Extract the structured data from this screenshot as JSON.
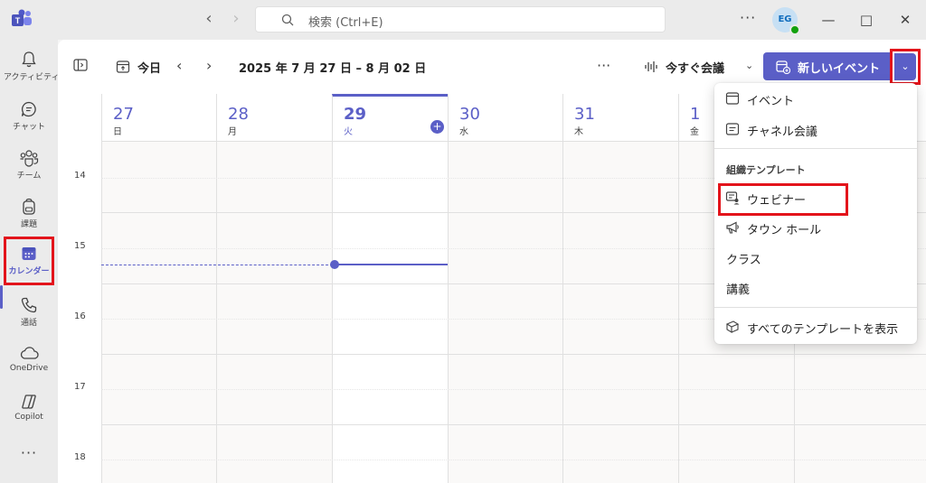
{
  "titlebar": {
    "search_placeholder": "検索 (Ctrl+E)",
    "more": "···",
    "avatar_initials": "EG",
    "minimize": "—",
    "maximize": "□",
    "close": "✕"
  },
  "rail": {
    "items": [
      {
        "label": "アクティビティ",
        "icon": "bell-icon"
      },
      {
        "label": "チャット",
        "icon": "chat-icon"
      },
      {
        "label": "チーム",
        "icon": "teams-icon"
      },
      {
        "label": "課題",
        "icon": "backpack-icon"
      },
      {
        "label": "カレンダー",
        "icon": "calendar-icon",
        "active": true
      },
      {
        "label": "通話",
        "icon": "phone-icon"
      },
      {
        "label": "OneDrive",
        "icon": "cloud-icon"
      },
      {
        "label": "Copilot",
        "icon": "copilot-icon"
      }
    ],
    "more": "···"
  },
  "toolbar": {
    "today_label": "今日",
    "date_range": "2025 年 7 月 27 日 – 8 月 02 日",
    "more": "···",
    "meet_now_label": "今すぐ会議",
    "new_event_label": "新しいイベント"
  },
  "calendar": {
    "days": [
      {
        "num": "27",
        "weekday": "日"
      },
      {
        "num": "28",
        "weekday": "月"
      },
      {
        "num": "29",
        "weekday": "火",
        "today": true
      },
      {
        "num": "30",
        "weekday": "水"
      },
      {
        "num": "31",
        "weekday": "木"
      },
      {
        "num": "1",
        "weekday": "金"
      }
    ],
    "hours": [
      "14",
      "15",
      "16",
      "17",
      "18"
    ]
  },
  "dropdown": {
    "event": "イベント",
    "channel_meeting": "チャネル会議",
    "org_templates_header": "組織テンプレート",
    "webinar": "ウェビナー",
    "town_hall": "タウン ホール",
    "class": "クラス",
    "lecture": "講義",
    "view_all_templates": "すべてのテンプレートを表示"
  },
  "colors": {
    "accent": "#5b5fc7",
    "highlight_box": "#e3141b"
  }
}
